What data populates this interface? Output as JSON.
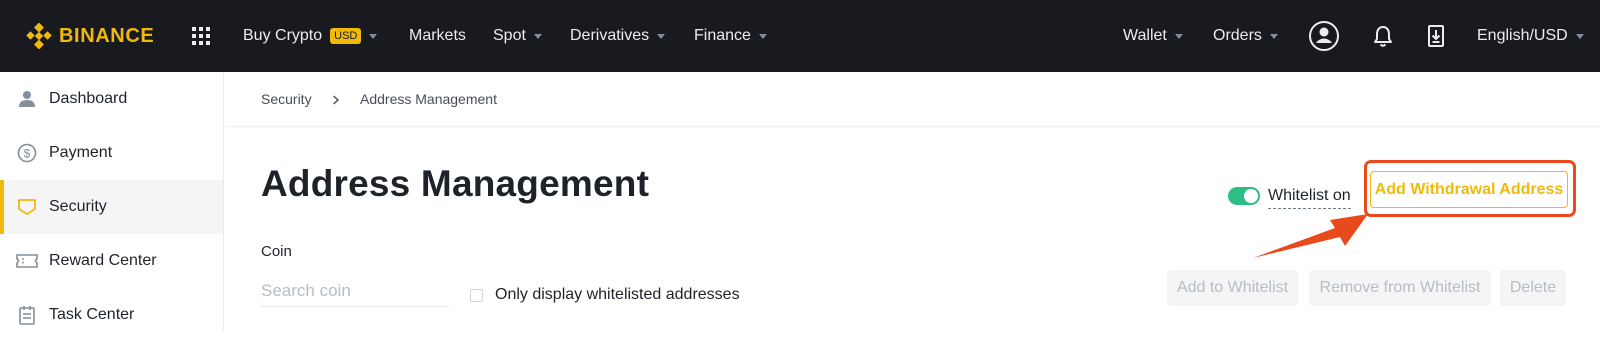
{
  "header": {
    "brand": "BINANCE",
    "nav": {
      "buy_crypto": "Buy Crypto",
      "buy_crypto_badge": "USD",
      "markets": "Markets",
      "spot": "Spot",
      "derivatives": "Derivatives",
      "finance": "Finance",
      "wallet": "Wallet",
      "orders": "Orders",
      "language": "English/USD"
    },
    "icons": [
      "apps-grid-icon",
      "user-icon",
      "bell-icon",
      "download-icon"
    ]
  },
  "sidebar": {
    "items": [
      {
        "label": "Dashboard",
        "icon": "user-icon",
        "active": false
      },
      {
        "label": "Payment",
        "icon": "dollar-icon",
        "active": false
      },
      {
        "label": "Security",
        "icon": "shield-icon",
        "active": true
      },
      {
        "label": "Reward Center",
        "icon": "ticket-icon",
        "active": false
      },
      {
        "label": "Task Center",
        "icon": "clipboard-icon",
        "active": false
      }
    ]
  },
  "breadcrumb": {
    "parent": "Security",
    "current": "Address Management"
  },
  "main": {
    "title": "Address Management",
    "whitelist_label": "Whitelist on",
    "whitelist_enabled": true,
    "add_button": "Add Withdrawal Address",
    "coin_label": "Coin",
    "search_placeholder": "Search coin",
    "only_whitelisted_label": "Only display whitelisted addresses",
    "add_to_whitelist": "Add to Whitelist",
    "remove_from_whitelist": "Remove from Whitelist",
    "delete": "Delete"
  },
  "colors": {
    "brand": "#f0b90b",
    "topbar": "#181a20",
    "toggle_on": "#2ebd85",
    "annotation": "#e84a1b"
  }
}
